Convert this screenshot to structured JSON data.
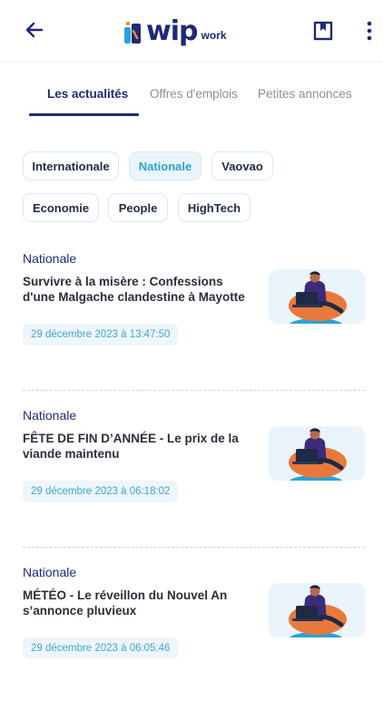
{
  "header": {
    "logo_main": "wip",
    "logo_sub": "work",
    "icons": {
      "back": "arrow-left-icon",
      "bookmark": "bookmark-icon",
      "more": "more-vertical-icon"
    },
    "brand_color": "#1e2a78",
    "accent_color": "#29a3d6"
  },
  "tabs": [
    {
      "label": "Les actualités",
      "active": true
    },
    {
      "label": "Offres d'emplois",
      "active": false
    },
    {
      "label": "Petites annonces",
      "active": false
    }
  ],
  "categories": [
    {
      "label": "Internationale",
      "selected": false
    },
    {
      "label": "Nationale",
      "selected": true
    },
    {
      "label": "Vaovao",
      "selected": false
    },
    {
      "label": "Economie",
      "selected": false
    },
    {
      "label": "People",
      "selected": false
    },
    {
      "label": "HighTech",
      "selected": false
    }
  ],
  "articles": [
    {
      "category": "Nationale",
      "title": "Survivre à la misère : Confessions d'une Malgache clandestine à Mayotte",
      "date": "29 décembre 2023 à 13:47:50",
      "thumbnail": "person-laptop-illustration"
    },
    {
      "category": "Nationale",
      "title": "FÊTE DE FIN D’ANNÉE - Le prix de la viande maintenu",
      "date": "29 décembre 2023 à 06:18:02",
      "thumbnail": "person-laptop-illustration"
    },
    {
      "category": "Nationale",
      "title": "MÉTÉO - Le réveillon du Nouvel An s’annonce pluvieux",
      "date": "29 décembre 2023 à 06:05:46",
      "thumbnail": "person-laptop-illustration"
    }
  ]
}
